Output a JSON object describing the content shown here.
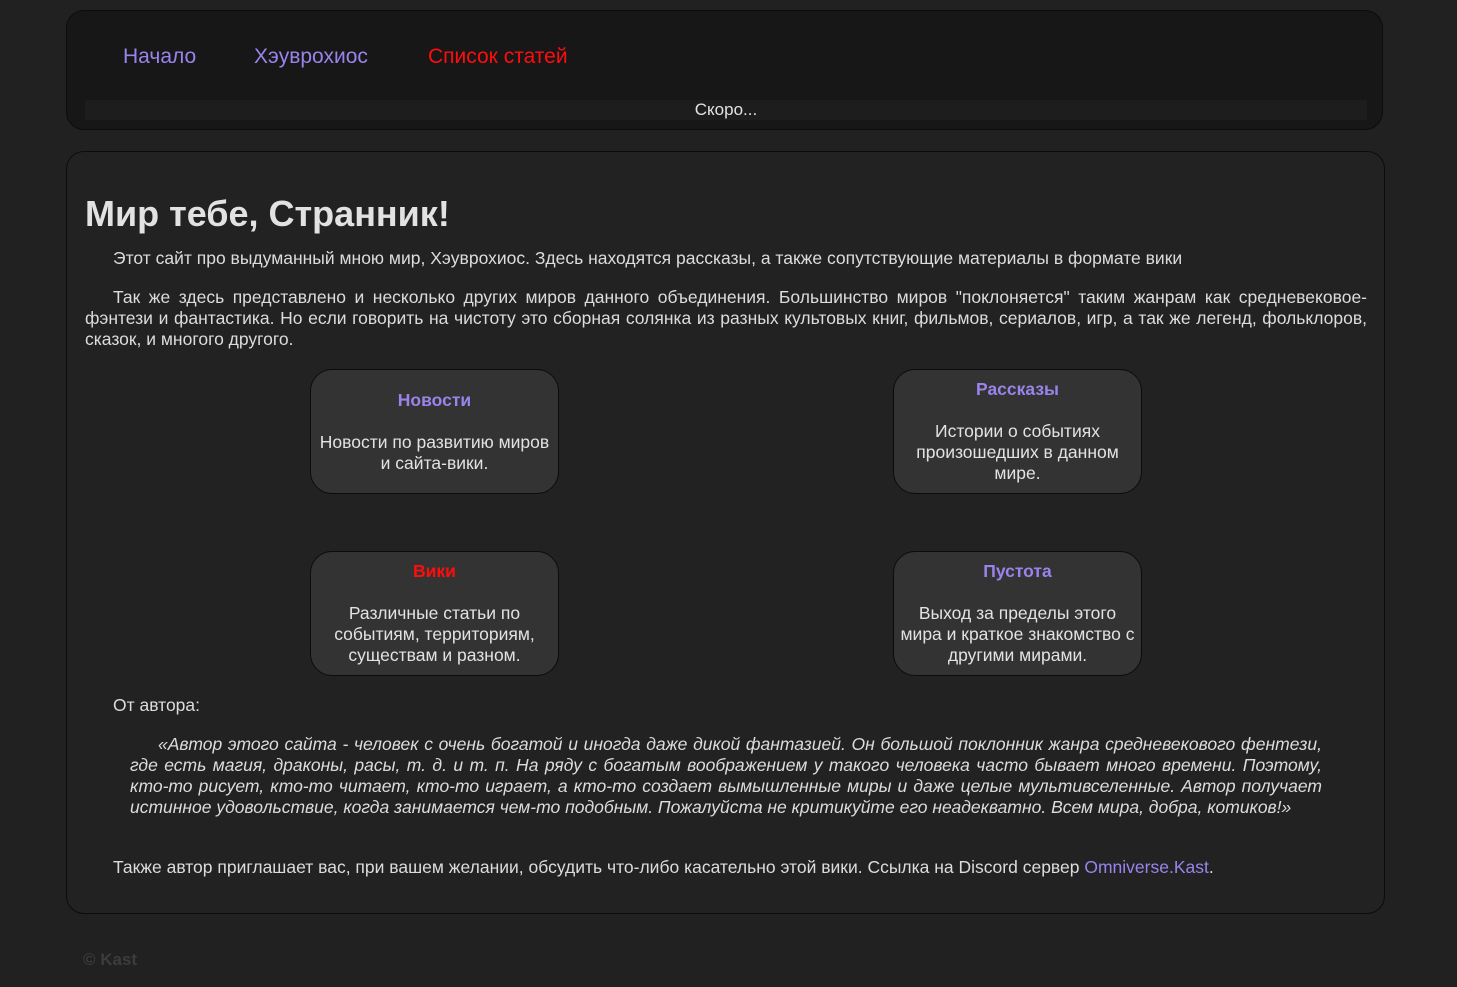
{
  "nav": {
    "items": [
      {
        "label": "Начало"
      },
      {
        "label": "Хэуврохиос"
      },
      {
        "label": "Список статей"
      }
    ],
    "active_color": "#ff0d0d",
    "link_color": "#9a84ec"
  },
  "ticker": {
    "text": "Скоро..."
  },
  "main": {
    "title": "Мир тебе, Странник!",
    "intro1": "Этот сайт про выдуманный мною мир, Хэуврохиос. Здесь находятся рассказы, а также сопутствующие материалы в формате вики",
    "intro2": "Так же здесь представлено и несколько других миров данного объединения. Большинство миров \"поклоняется\" таким жанрам как средневековое-фэнтези и фантастика. Но если говорить на чистоту это сборная солянка из разных культовых книг, фильмов, сериалов, игр, а так же легенд, фольклоров, сказок, и многого другого.",
    "cards": [
      {
        "title": "Новости",
        "desc": "Новости по развитию миров и сайта-вики."
      },
      {
        "title": "Рассказы",
        "desc": "Истории о событиях произошедших в данном мире."
      },
      {
        "title": "Вики",
        "desc": "Различные статьи по событиям, территориям, существам и разном."
      },
      {
        "title": "Пустота",
        "desc": "Выход за пределы этого мира и краткое знакомство с другими мирами."
      }
    ],
    "author_label": "От автора:",
    "quote": "«Автор этого сайта - человек с очень богатой и иногда даже дикой фантазией. Он большой поклонник жанра средневекового фентези, где есть магия, драконы, расы, т. д. и т. п. На ряду с богатым воображением у такого человека часто бывает много времени. Поэтому, кто-то рисует, кто-то читает, кто-то играет, а кто-то создает вымышленные миры и даже целые мультивселенные. Автор получает истинное удовольствие, когда занимается чем-то подобным. Пожалуйста не критикуйте его неадекватно. Всем мира, добра, котиков!»",
    "invite_text": "Также автор приглашает вас, при вашем желании, обсудить что-либо касательно этой вики. Ссылка на Discord сервер ",
    "invite_link": "Omniverse.Kast",
    "invite_end": "."
  },
  "footer": {
    "text": "© Kast"
  }
}
